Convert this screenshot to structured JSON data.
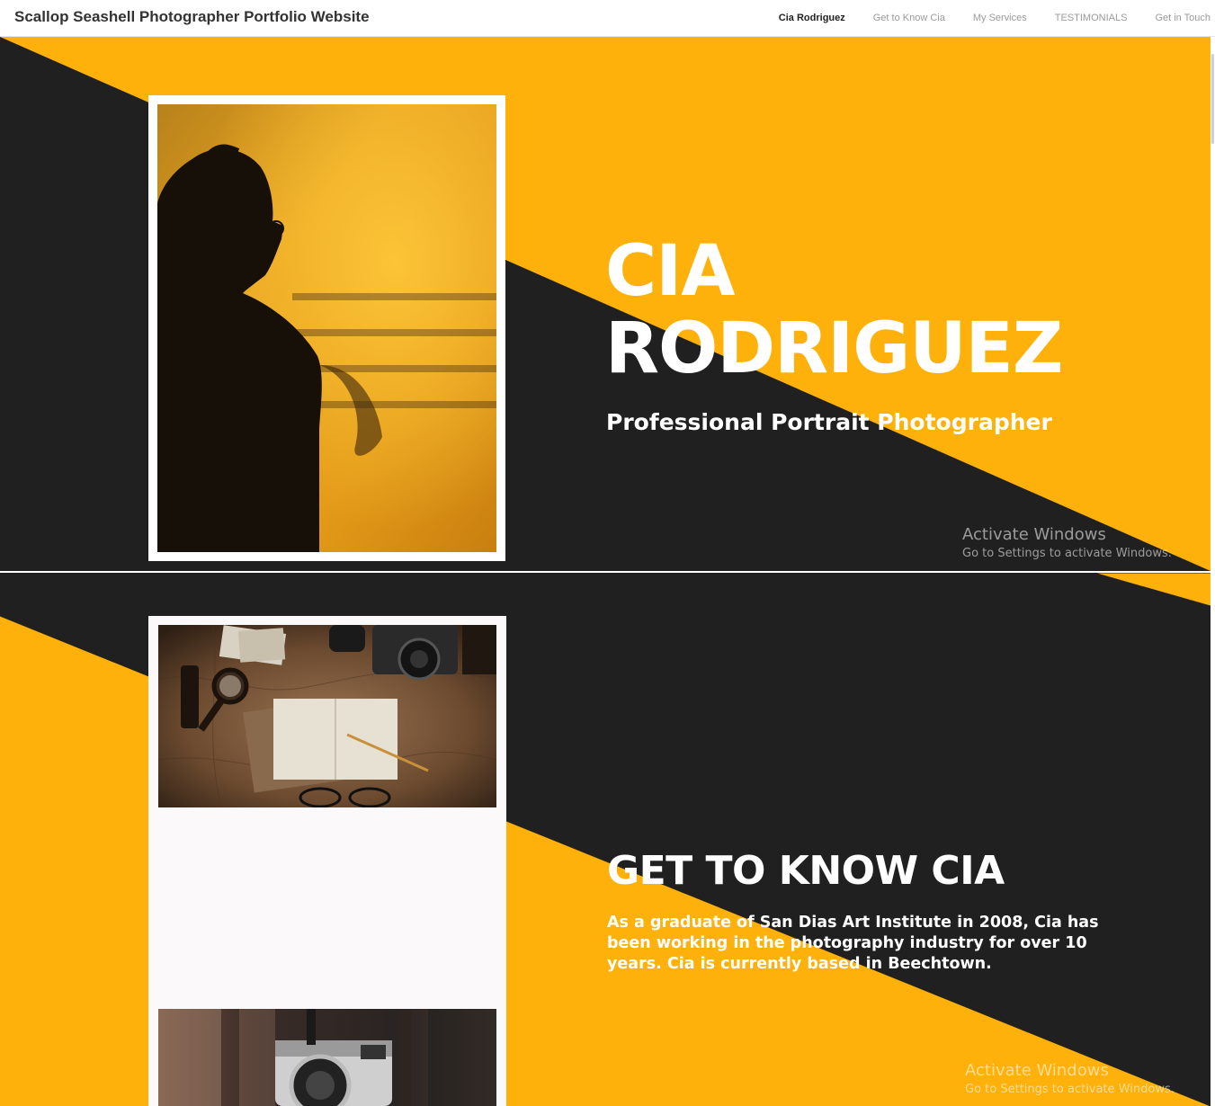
{
  "site": {
    "title": "Scallop Seashell Photographer Portfolio Website"
  },
  "nav": {
    "items": [
      {
        "label": "Cia Rodriguez",
        "active": true
      },
      {
        "label": "Get to Know Cia",
        "active": false
      },
      {
        "label": "My Services",
        "active": false
      },
      {
        "label": "TESTIMONIALS",
        "active": false
      },
      {
        "label": "Get in Touch",
        "active": false
      }
    ]
  },
  "hero": {
    "name_line1": "CIA",
    "name_line2": "RODRIGUEZ",
    "subtitle": "Professional Portrait Photographer"
  },
  "about": {
    "title": "GET TO KNOW CIA",
    "body": "As a graduate of San Dias Art Institute in 2008, Cia has been working in the photography industry for over 10 years. Cia is currently based in Beechtown."
  },
  "watermark": {
    "title": "Activate Windows",
    "subtitle": "Go to Settings to activate Windows."
  },
  "colors": {
    "accent": "#fdb10a",
    "dark": "#212020",
    "text_light": "#ffffff"
  },
  "images": {
    "hero_photo": "silhouette-portrait",
    "about_photo_top": "flatlay-notebook-cameras-map",
    "about_photo_bottom": "vintage-camera-closeup"
  }
}
